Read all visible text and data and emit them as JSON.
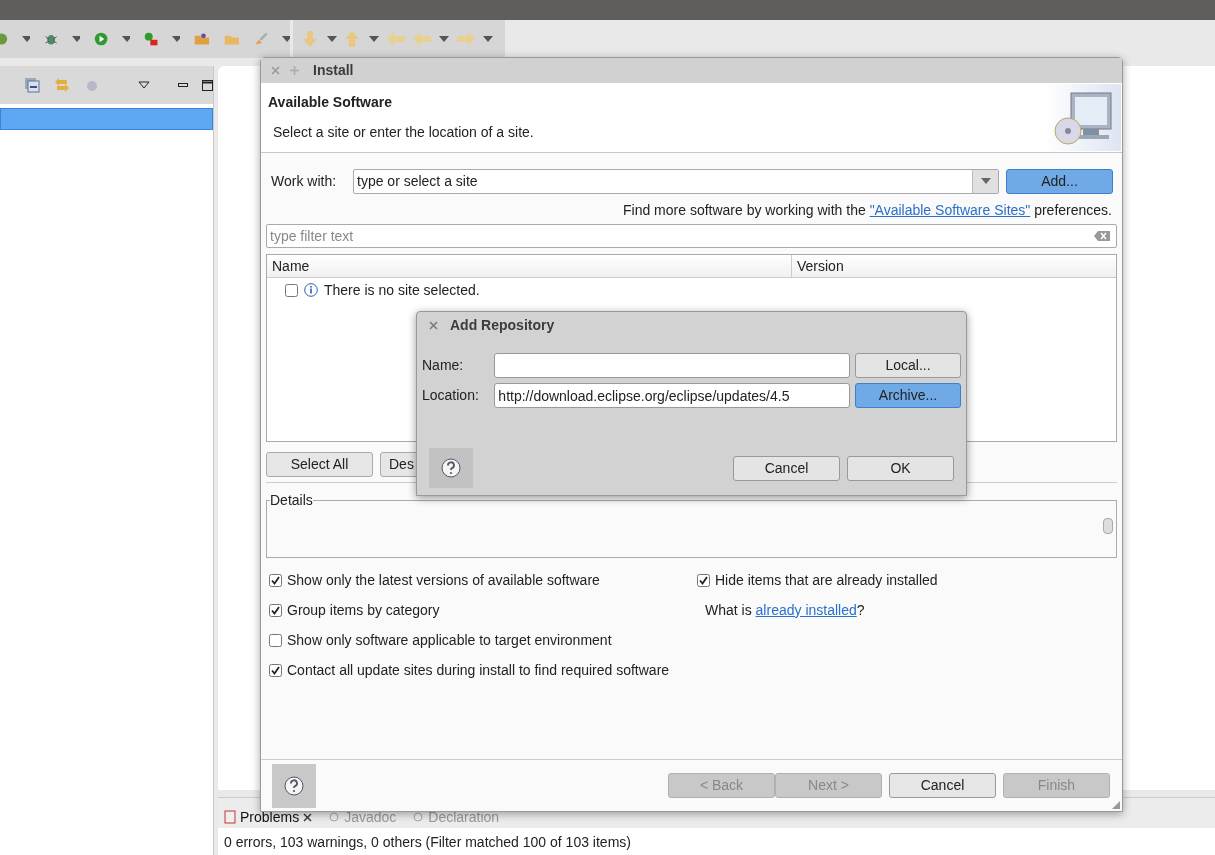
{
  "install_dialog": {
    "title": "Install",
    "header_title": "Available Software",
    "header_message": "Select a site or enter the location of a site.",
    "work_with_label": "Work with:",
    "work_with_placeholder": "type or select a site",
    "add_button": {
      "label": "Add...",
      "default": true
    },
    "sites_hint": {
      "before": "Find more software by working with the ",
      "link": "\"Available Software Sites\"",
      "after": " preferences."
    },
    "filter_placeholder": "type filter text",
    "columns": [
      "Name",
      "Version"
    ],
    "rows": [
      {
        "text": "There is no site selected.",
        "checked": false
      }
    ],
    "list_buttons": [
      "Select All",
      "Des"
    ],
    "details_label": "Details",
    "options": [
      {
        "label": "Show only the latest versions of available software",
        "checked": true
      },
      {
        "label": "Group items by category",
        "checked": true
      },
      {
        "label": "Show only software applicable to target environment",
        "checked": false
      },
      {
        "label": "Contact all update sites during install to find required software",
        "checked": true
      }
    ],
    "hide_installed": {
      "label": "Hide items that are already installed",
      "checked": true
    },
    "installed_hint": {
      "before": "What is ",
      "link": "already installed",
      "after": "?"
    },
    "buttons": [
      {
        "label": "< Back",
        "disabled": true
      },
      {
        "label": "Next >",
        "disabled": true
      },
      {
        "label": "Cancel",
        "disabled": false
      },
      {
        "label": "Finish",
        "disabled": true
      }
    ]
  },
  "add_repository": {
    "title": "Add Repository",
    "name_label": "Name:",
    "location_label": "Location:",
    "location_value": "http://download.eclipse.org/eclipse/updates/4.5",
    "side_buttons": [
      {
        "label": "Local...",
        "default": false
      },
      {
        "label": "Archive...",
        "default": true
      }
    ],
    "buttons": [
      "Cancel",
      "OK"
    ]
  },
  "bottom_panel": {
    "tabs": [
      {
        "label": "Problems",
        "selected": true
      },
      {
        "label": "Javadoc",
        "selected": false
      },
      {
        "label": "Declaration",
        "selected": false
      }
    ],
    "status": "0 errors, 103 warnings, 0 others (Filter matched 100 of 103 items)"
  }
}
